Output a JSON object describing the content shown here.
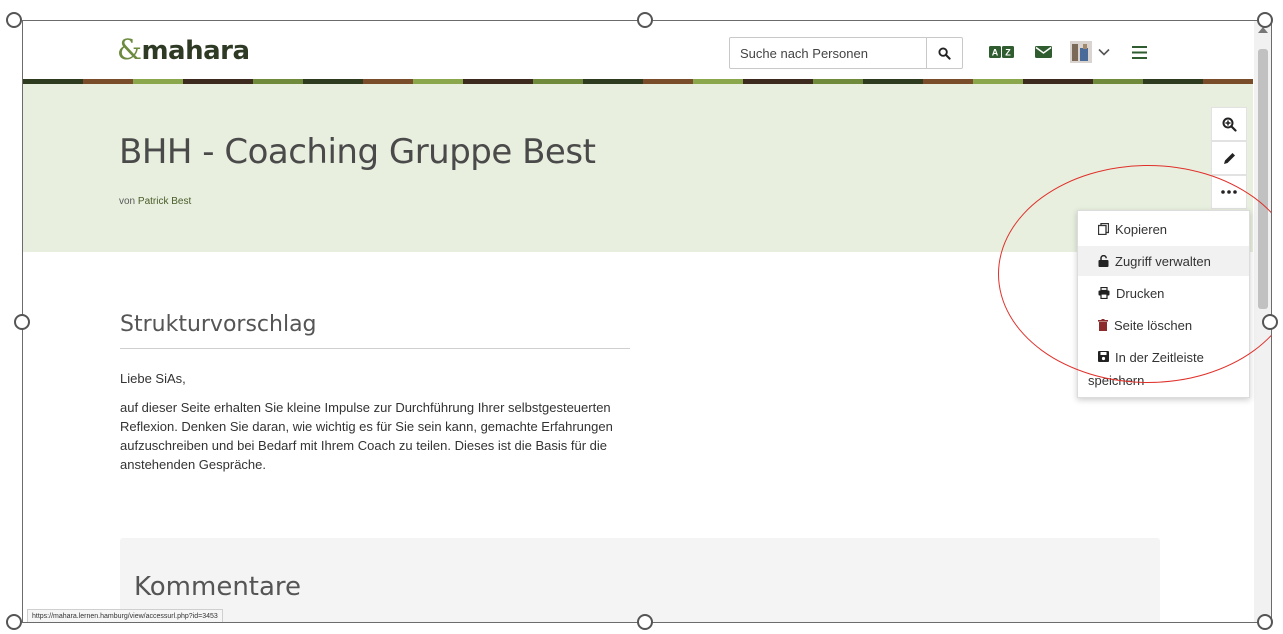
{
  "header": {
    "logo_text": "mahara",
    "logo_symbol": "&",
    "search_placeholder": "Suche nach Personen",
    "icons": [
      "search-icon",
      "language-icon",
      "mail-icon",
      "avatar-icon",
      "chevron-down-icon",
      "hamburger-menu-icon"
    ]
  },
  "page": {
    "title": "BHH - Coaching Gruppe Best",
    "byline_prefix": "von",
    "author": "Patrick Best"
  },
  "side_actions": [
    "zoom-icon",
    "edit-icon",
    "more-icon"
  ],
  "menu": {
    "items": [
      {
        "label": "Kopieren",
        "icon": "copy-icon"
      },
      {
        "label": "Zugriff verwalten",
        "icon": "unlock-icon"
      },
      {
        "label": "Drucken",
        "icon": "print-icon"
      },
      {
        "label": "Seite löschen",
        "icon": "trash-icon"
      },
      {
        "label": "In der Zeitleiste",
        "icon": "save-icon"
      }
    ],
    "wrap_text": "speichern"
  },
  "content": {
    "section_title": "Strukturvorschlag",
    "greeting": "Liebe SiAs,",
    "paragraph": "auf dieser Seite erhalten Sie kleine Impulse zur Durchführung Ihrer selbstgesteuerten Reflexion. Denken Sie daran, wie wichtig es für Sie sein kann, gemachte Erfahrungen aufzuschreiben und bei Bedarf mit Ihrem Coach zu teilen. Dieses ist die Basis für die anstehenden Gespräche."
  },
  "comments": {
    "title": "Kommentare"
  },
  "status_bar": {
    "url": "https://mahara.lernen.hamburg/view/accessurl.php?id=3453"
  },
  "colors": {
    "banner": "#e8efdf",
    "logo": "#2f3a25",
    "annotation": "#e0302a",
    "author_link": "#4a5d2a"
  }
}
